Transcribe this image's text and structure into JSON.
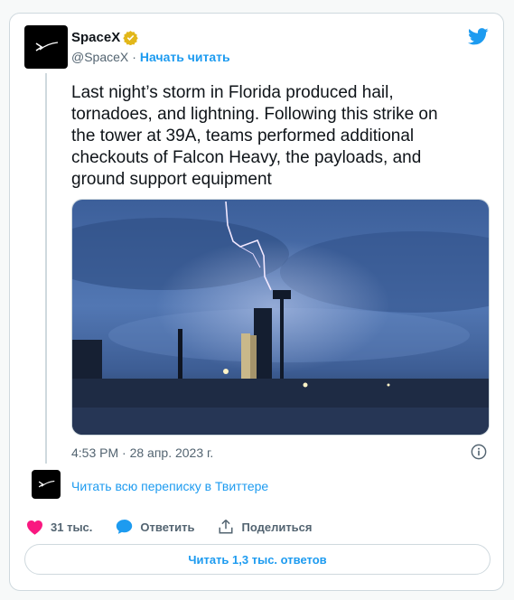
{
  "author": {
    "name": "SpaceX",
    "handle": "@SpaceX",
    "separator": "·",
    "follow_label": "Начать читать"
  },
  "tweet": {
    "text": "Last night’s storm in Florida produced hail,\ntornadoes, and lightning. Following this strike on\nthe tower at 39A, teams performed additional\ncheckouts of Falcon Heavy, the payloads, and\nground support equipment",
    "timestamp": "4:53 PM · 28 апр. 2023 г."
  },
  "thread": {
    "read_label": "Читать всю переписку в Твиттере"
  },
  "actions": {
    "likes": "31 тыс.",
    "reply_label": "Ответить",
    "share_label": "Поделиться"
  },
  "replies_button": "Читать 1,3 тыс. ответов",
  "colors": {
    "accent": "#1d9bf0",
    "like": "#f91880",
    "verified": "#e2b719",
    "muted": "#536471"
  },
  "icons": [
    "spacex-logo-icon",
    "verified-badge-icon",
    "twitter-bird-icon",
    "info-icon",
    "heart-icon",
    "reply-icon",
    "share-icon"
  ]
}
